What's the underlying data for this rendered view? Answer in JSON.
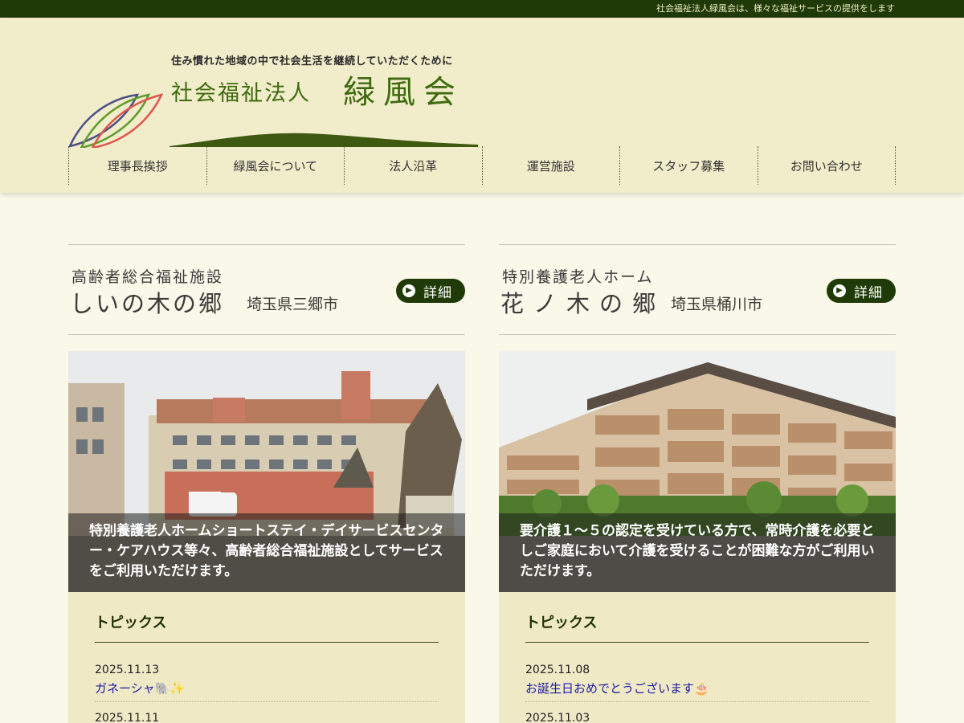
{
  "topbar": {
    "text": "社会福祉法人緑風会は、様々な福祉サービスの提供をします"
  },
  "logo": {
    "tagline": "住み慣れた地域の中で社会生活を継続していただくために",
    "corp_type": "社会福祉法人",
    "corp_name": "緑風会"
  },
  "nav": {
    "items": [
      "理事長挨拶",
      "緑風会について",
      "法人沿革",
      "運営施設",
      "スタッフ募集",
      "お問い合わせ"
    ]
  },
  "facilities": [
    {
      "type": "高齢者総合福祉施設",
      "name": "しいの木の郷",
      "location": "埼玉県三郷市",
      "detail_label": "詳細",
      "caption": "特別養護老人ホームショートステイ・デイサービスセンター・ケアハウス等々、高齢者総合福祉施設としてサービスをご利用いただけます。",
      "topics_title": "トピックス",
      "topics": [
        {
          "date": "2025.11.13",
          "title": "ガネーシャ🐘✨"
        },
        {
          "date": "2025.11.11"
        }
      ]
    },
    {
      "type": "特別養護老人ホーム",
      "name": "花ノ木の郷",
      "location": "埼玉県桶川市",
      "detail_label": "詳細",
      "caption": "要介護１～５の認定を受けている方で、常時介護を必要としご家庭において介護を受けることが困難な方がご利用いただけます。",
      "topics_title": "トピックス",
      "topics": [
        {
          "date": "2025.11.08",
          "title": "お誕生日おめでとうございます🎂"
        },
        {
          "date": "2025.11.03"
        }
      ]
    }
  ],
  "colors": {
    "header_bg": "#f1ecca",
    "topbar_bg": "#1f3a06",
    "accent_green": "#3f6b10",
    "link": "#1a1aa6"
  }
}
